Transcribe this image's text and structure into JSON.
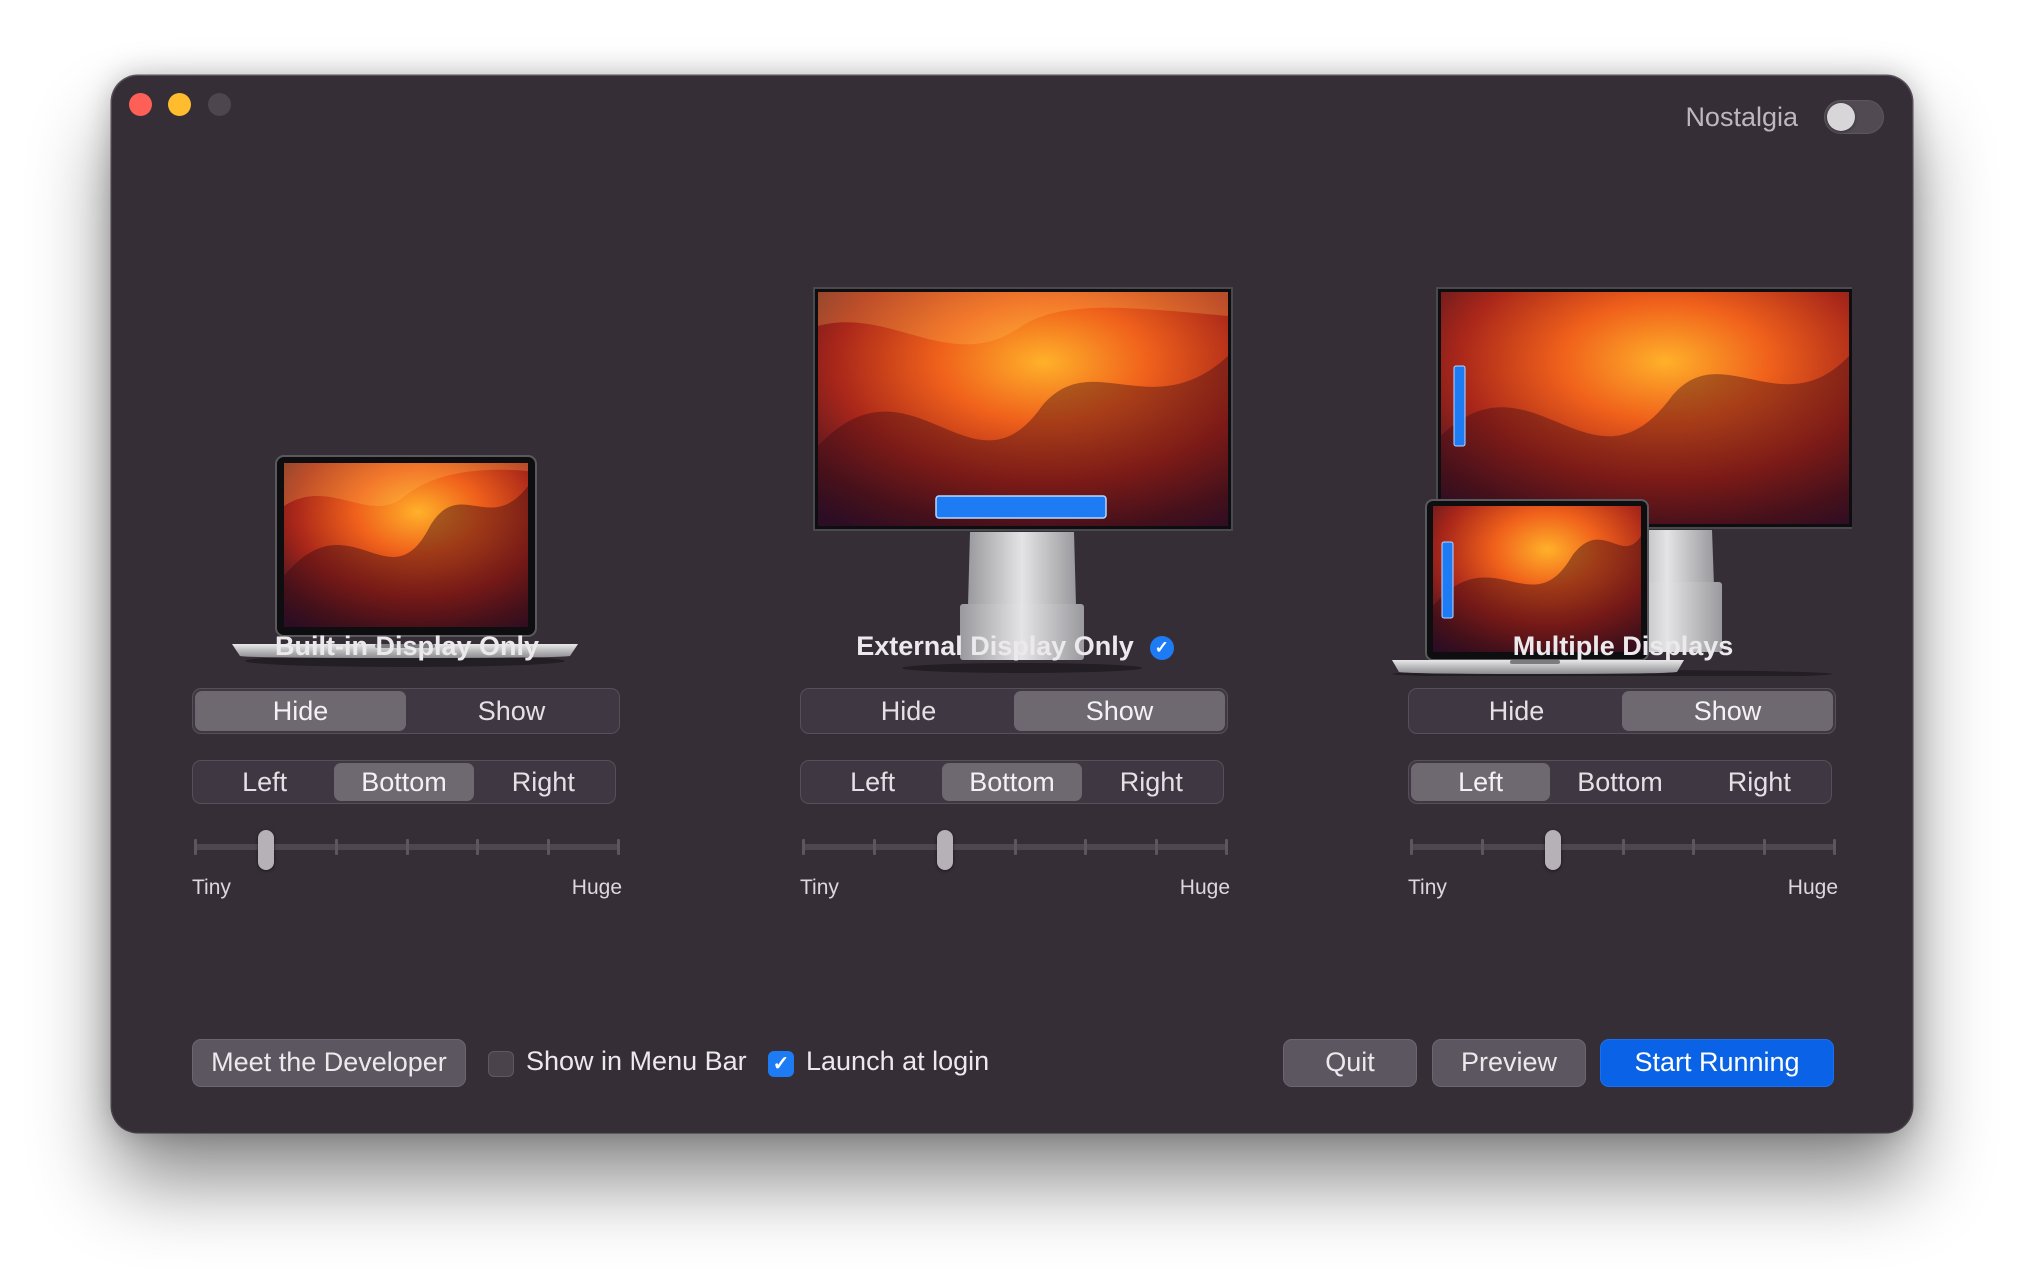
{
  "window": {
    "nostalgia": {
      "label": "Nostalgia",
      "enabled": false
    }
  },
  "columns": [
    {
      "title": "Built-in Display Only",
      "checked": false,
      "visibility": {
        "options": [
          "Hide",
          "Show"
        ],
        "selected": "Hide"
      },
      "position": {
        "options": [
          "Left",
          "Bottom",
          "Right"
        ],
        "selected": "Bottom"
      },
      "size": {
        "min_label": "Tiny",
        "max_label": "Huge",
        "step": 1,
        "steps": 6
      }
    },
    {
      "title": "External Display Only",
      "checked": true,
      "visibility": {
        "options": [
          "Hide",
          "Show"
        ],
        "selected": "Show"
      },
      "position": {
        "options": [
          "Left",
          "Bottom",
          "Right"
        ],
        "selected": "Bottom"
      },
      "size": {
        "min_label": "Tiny",
        "max_label": "Huge",
        "step": 2,
        "steps": 6
      }
    },
    {
      "title": "Multiple Displays",
      "checked": false,
      "visibility": {
        "options": [
          "Hide",
          "Show"
        ],
        "selected": "Show"
      },
      "position": {
        "options": [
          "Left",
          "Bottom",
          "Right"
        ],
        "selected": "Left"
      },
      "size": {
        "min_label": "Tiny",
        "max_label": "Huge",
        "step": 2,
        "steps": 6
      }
    }
  ],
  "footer": {
    "meet_developer": "Meet the Developer",
    "show_in_menu_bar": {
      "label": "Show in Menu Bar",
      "checked": false
    },
    "launch_at_login": {
      "label": "Launch at login",
      "checked": true
    },
    "quit": "Quit",
    "preview": "Preview",
    "start_running": "Start Running"
  },
  "colors": {
    "window_bg": "#362e37",
    "accent": "#1d7cf4",
    "primary_button": "#0a62e6"
  }
}
